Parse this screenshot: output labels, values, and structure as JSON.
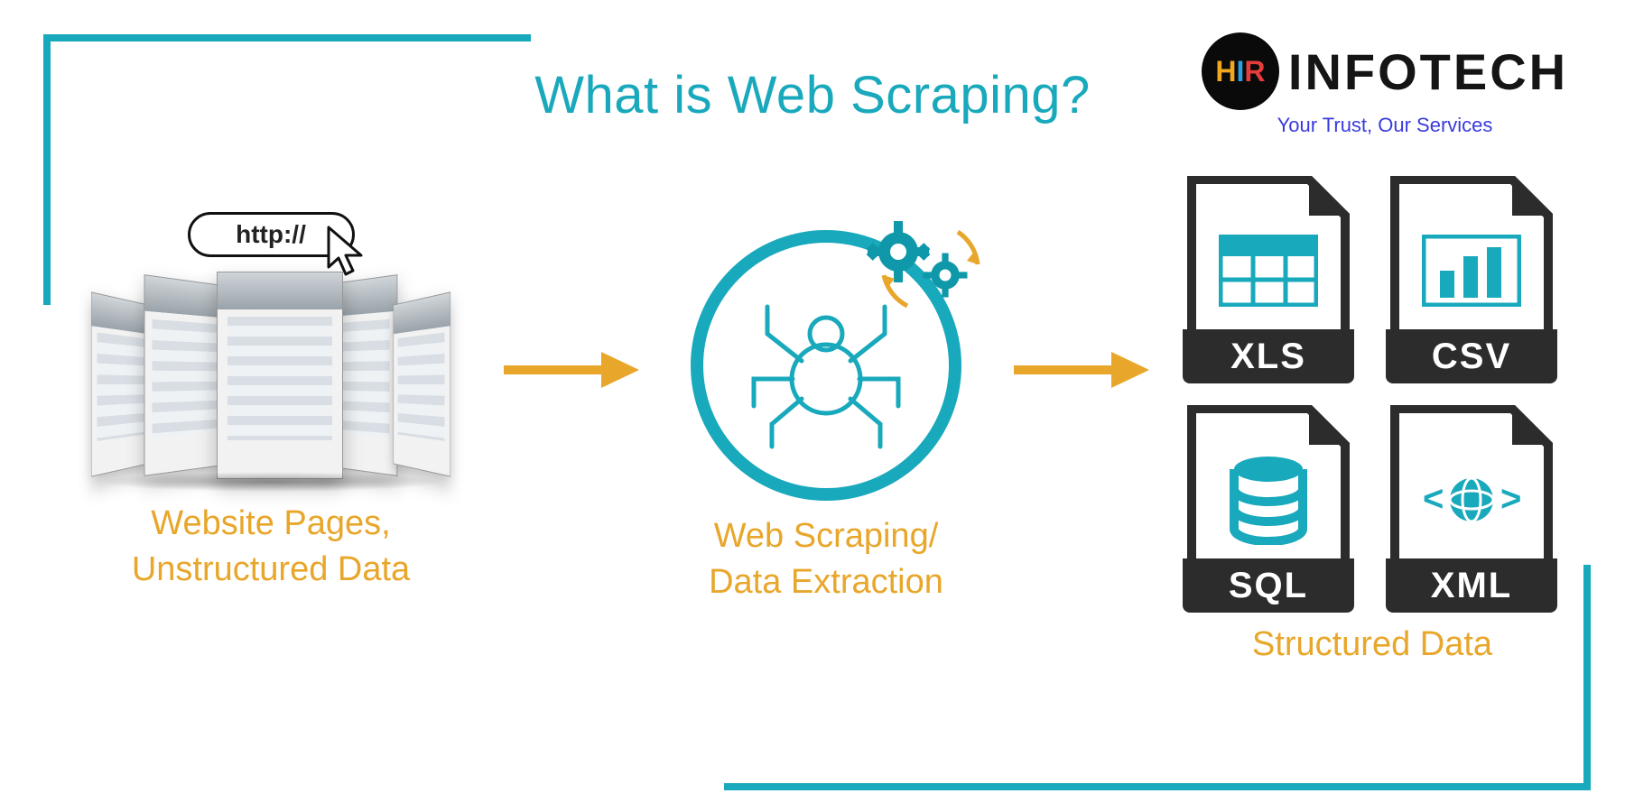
{
  "title": "What is Web Scraping?",
  "logo": {
    "mark_letters": [
      "H",
      "I",
      "R"
    ],
    "wordmark": "INFOTECH",
    "tagline": "Your Trust, Our Services"
  },
  "colors": {
    "teal": "#19a9bc",
    "amber": "#e8a62a",
    "dark": "#2c2c2c"
  },
  "stage1": {
    "http_label": "http://",
    "caption_line1": "Website Pages,",
    "caption_line2": "Unstructured Data"
  },
  "stage2": {
    "caption_line1": "Web Scraping/",
    "caption_line2": "Data Extraction"
  },
  "stage3": {
    "files": [
      "XLS",
      "CSV",
      "SQL",
      "XML"
    ],
    "caption": "Structured Data"
  }
}
